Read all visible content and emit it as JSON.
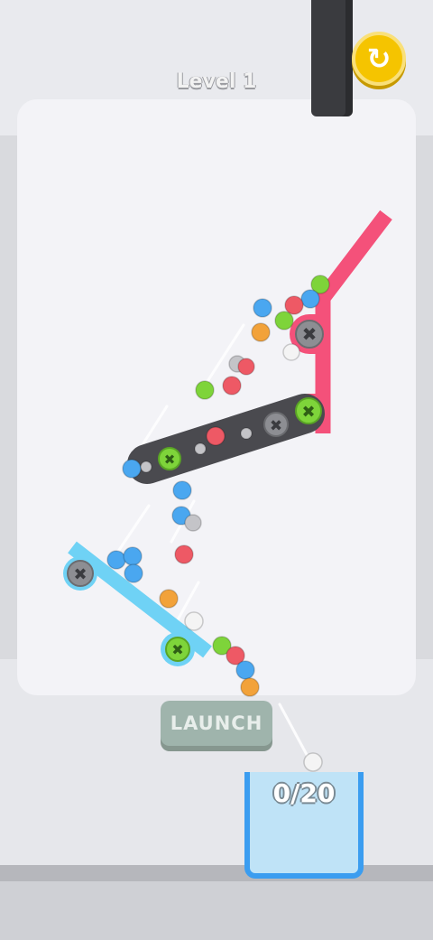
{
  "hud": {
    "level_label": "Level 1",
    "restart_icon": "restart-icon"
  },
  "launch_button": {
    "label": "LAUNCH",
    "enabled": false
  },
  "cup": {
    "counter": "0/20"
  },
  "colors": {
    "pink_bar": "#f4517a",
    "dark_bar": "#4a4a4f",
    "cyan_bar": "#6fd2f5",
    "green_pin": "#7ed43a",
    "grey_pin": "#8d8e93",
    "ball_green": "#7ed43a",
    "ball_red": "#ee5965",
    "ball_blue": "#4aa7f0",
    "ball_orange": "#f2a23a",
    "ball_white": "#f4f4f4",
    "ball_grey": "#c4c4c8"
  },
  "balls": {
    "colors": [
      "green",
      "blue",
      "red",
      "blue",
      "green",
      "orange",
      "white",
      "grey",
      "red",
      "red",
      "green",
      "blue",
      "grey",
      "grey",
      "red",
      "grey",
      "blue",
      "blue",
      "grey",
      "red",
      "blue",
      "blue",
      "blue",
      "orange",
      "white",
      "green",
      "red",
      "blue",
      "orange",
      "white"
    ]
  }
}
